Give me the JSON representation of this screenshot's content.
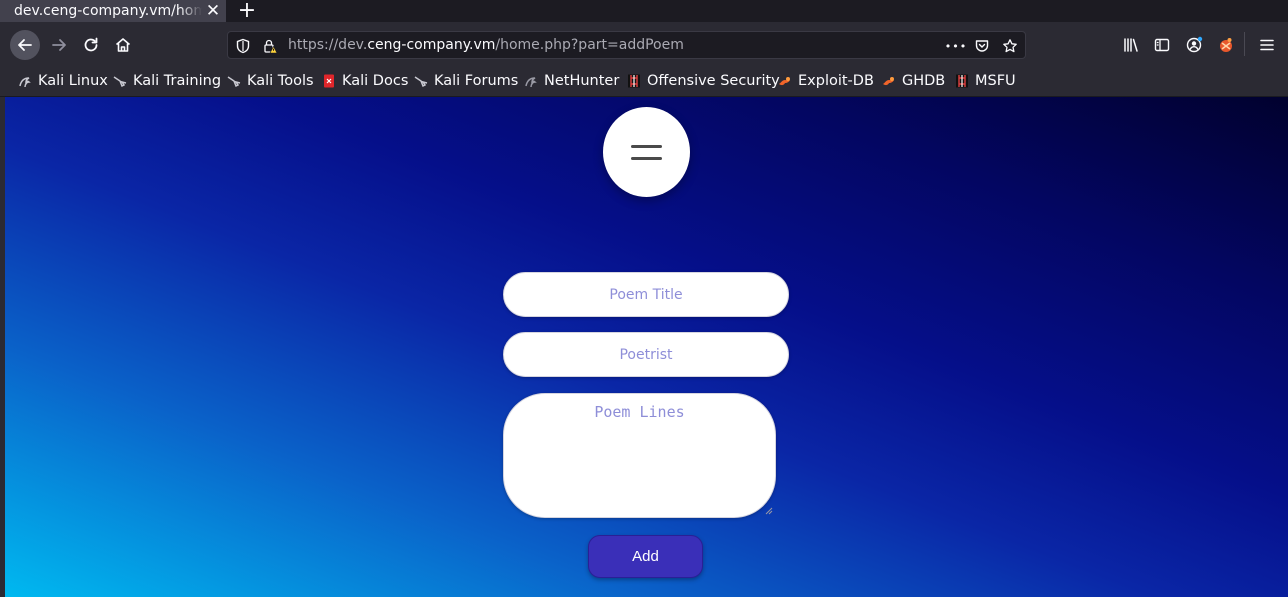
{
  "browser": {
    "tab": {
      "title": "dev.ceng-company.vm/home.php?part=addPoem",
      "close_glyph": "✕"
    },
    "new_tab_glyph": "+",
    "url": {
      "scheme": "https://dev.",
      "host": "ceng-company.vm",
      "path": "/home.php?part=addPoem"
    },
    "urlbar_more_glyph": "•••"
  },
  "bookmarks": [
    {
      "label": "Kali Linux",
      "icon": "kali-dragon-icon"
    },
    {
      "label": "Kali Training",
      "icon": "kali-dragon-icon"
    },
    {
      "label": "Kali Tools",
      "icon": "kali-dragon-icon"
    },
    {
      "label": "Kali Docs",
      "icon": "kali-docs-icon"
    },
    {
      "label": "Kali Forums",
      "icon": "kali-dragon-icon"
    },
    {
      "label": "NetHunter",
      "icon": "nethunter-icon"
    },
    {
      "label": "Offensive Security",
      "icon": "offsec-icon"
    },
    {
      "label": "Exploit-DB",
      "icon": "exploitdb-icon"
    },
    {
      "label": "GHDB",
      "icon": "exploitdb-icon"
    },
    {
      "label": "MSFU",
      "icon": "offsec-icon"
    }
  ],
  "form": {
    "title_placeholder": "Poem Title",
    "poetrist_placeholder": "Poetrist",
    "lines_placeholder": "Poem Lines",
    "submit_label": "Add"
  },
  "colors": {
    "gradient_start": "#00b9f0",
    "gradient_mid": "#050f8a",
    "gradient_end": "#01012e",
    "button": "#3a2fb8",
    "placeholder": "#8e8ed8"
  }
}
